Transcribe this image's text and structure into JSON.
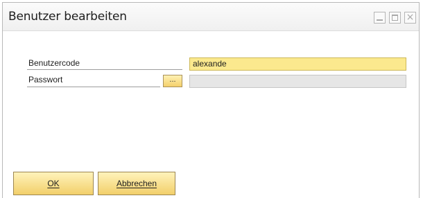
{
  "window": {
    "title": "Benutzer bearbeiten",
    "controls": {
      "minimize_icon": "minimize-icon",
      "maximize_icon": "maximize-icon",
      "close_glyph": "×"
    }
  },
  "form": {
    "user_code_label": "Benutzercode",
    "user_code_value": "alexande",
    "password_label": "Passwort",
    "password_browse_label": "...",
    "password_value": ""
  },
  "buttons": {
    "ok_label": "OK",
    "cancel_label": "Abbrechen"
  },
  "colors": {
    "active_field": "#fbe98e",
    "inactive_field": "#e6e6e6",
    "button_gradient_top": "#fff3bb",
    "button_gradient_bottom": "#f2cf6a"
  }
}
